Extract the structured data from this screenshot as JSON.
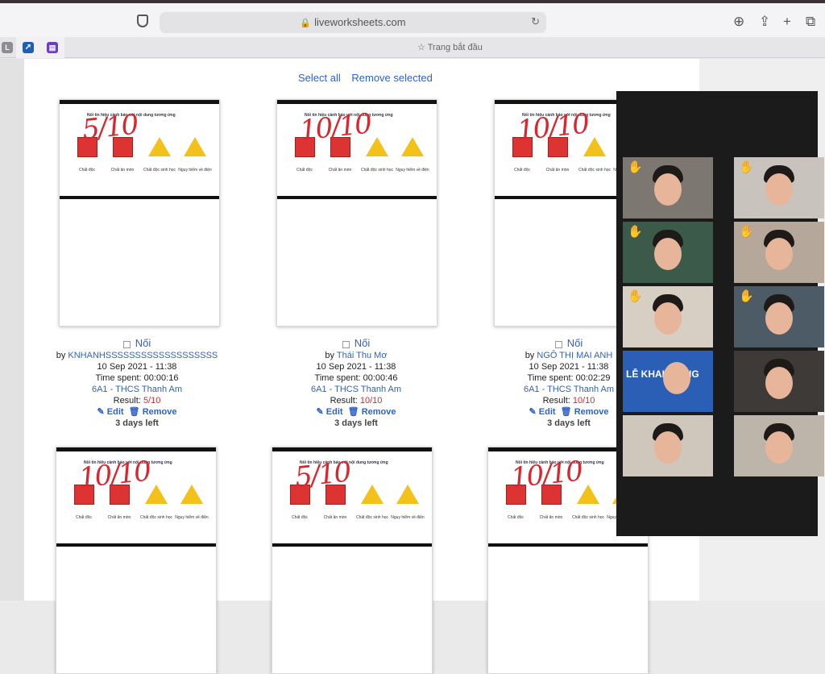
{
  "browser": {
    "url": "liveworksheets.com",
    "start_page_label": "Trang bắt đầu",
    "favicon_labels": [
      "L",
      "",
      ""
    ],
    "icons": [
      "shield-icon",
      "lock-icon",
      "reload-icon",
      "download-icon",
      "share-icon",
      "new-tab-icon",
      "tabs-overview-icon"
    ]
  },
  "toolbar": {
    "select_all": "Select all",
    "remove_selected": "Remove selected"
  },
  "worksheet_sheet": {
    "title": "Nối tín hiệu cảnh báo với nội dung tương ứng",
    "sign_labels": [
      "Chất độc",
      "Chất ăn mòn",
      "Chất độc sinh học",
      "Nguy hiểm về điện"
    ]
  },
  "cards": [
    {
      "score_mark": "5/10",
      "title": "Nối",
      "by_label": "by",
      "author": "KNHANHSSSSSSSSSSSSSSSSSSS",
      "date": "10 Sep 2021 - 11:38",
      "time_spent": "Time spent: 00:00:16",
      "class": "6A1 - THCS Thanh Am",
      "result_label": "Result:",
      "result": "5/10",
      "edit": "Edit",
      "remove": "Remove",
      "days_left": "3 days left"
    },
    {
      "score_mark": "10/10",
      "title": "Nối",
      "by_label": "by",
      "author": "Thái Thu Mơ",
      "date": "10 Sep 2021 - 11:38",
      "time_spent": "Time spent: 00:00:46",
      "class": "6A1 - THCS Thanh Am",
      "result_label": "Result:",
      "result": "10/10",
      "edit": "Edit",
      "remove": "Remove",
      "days_left": "3 days left"
    },
    {
      "score_mark": "10/10",
      "title": "Nối",
      "by_label": "by",
      "author": "NGÔ THỊ MAI ANH",
      "date": "10 Sep 2021 - 11:38",
      "time_spent": "Time spent: 00:02:29",
      "class": "6A1 - THCS Thanh Am",
      "result_label": "Result:",
      "result": "10/10",
      "edit": "Edit",
      "remove": "Remove",
      "days_left": "3 days left"
    },
    {
      "score_mark": "10/10"
    },
    {
      "score_mark": "5/10"
    },
    {
      "score_mark": "10/10"
    }
  ],
  "video_call": {
    "banner_text": "LỄ KHAI GIẢNG",
    "raised_hand_icon": "raised-hand-icon",
    "tile_colors": [
      "#7d7772",
      "#c9c3bd",
      "#3c5a4a",
      "#b5a79a",
      "#d7cfc3",
      "#4d5b66",
      "#2a5fb5",
      "#3e3a37",
      "#cfc7bb",
      "#bdb5aa"
    ]
  }
}
